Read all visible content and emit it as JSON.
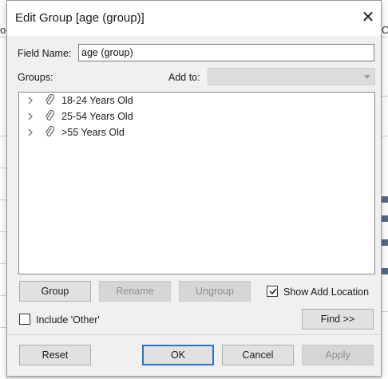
{
  "background": {
    "left_char": "o",
    "right_char": "C"
  },
  "dialog": {
    "title": "Edit Group [age (group)]",
    "close_icon": "close-icon",
    "field_name_label": "Field Name:",
    "field_name_value": "age (group)",
    "groups_label": "Groups:",
    "add_to_label": "Add to:",
    "add_to_value": "",
    "tree_items": [
      {
        "label": "18-24 Years Old",
        "icon": "paperclip-icon",
        "expanded": false
      },
      {
        "label": "25-54 Years Old",
        "icon": "paperclip-icon",
        "expanded": false
      },
      {
        "label": ">55 Years Old",
        "icon": "paperclip-icon",
        "expanded": false
      }
    ],
    "buttons": {
      "group": "Group",
      "rename": "Rename",
      "ungroup": "Ungroup",
      "find": "Find >>",
      "reset": "Reset",
      "ok": "OK",
      "cancel": "Cancel",
      "apply": "Apply"
    },
    "show_add_location": {
      "label": "Show Add Location",
      "checked": true
    },
    "include_other": {
      "label": "Include 'Other'",
      "checked": false
    },
    "colors": {
      "primary_border": "#2b74cc",
      "disabled_text": "#8d8d8d"
    }
  }
}
